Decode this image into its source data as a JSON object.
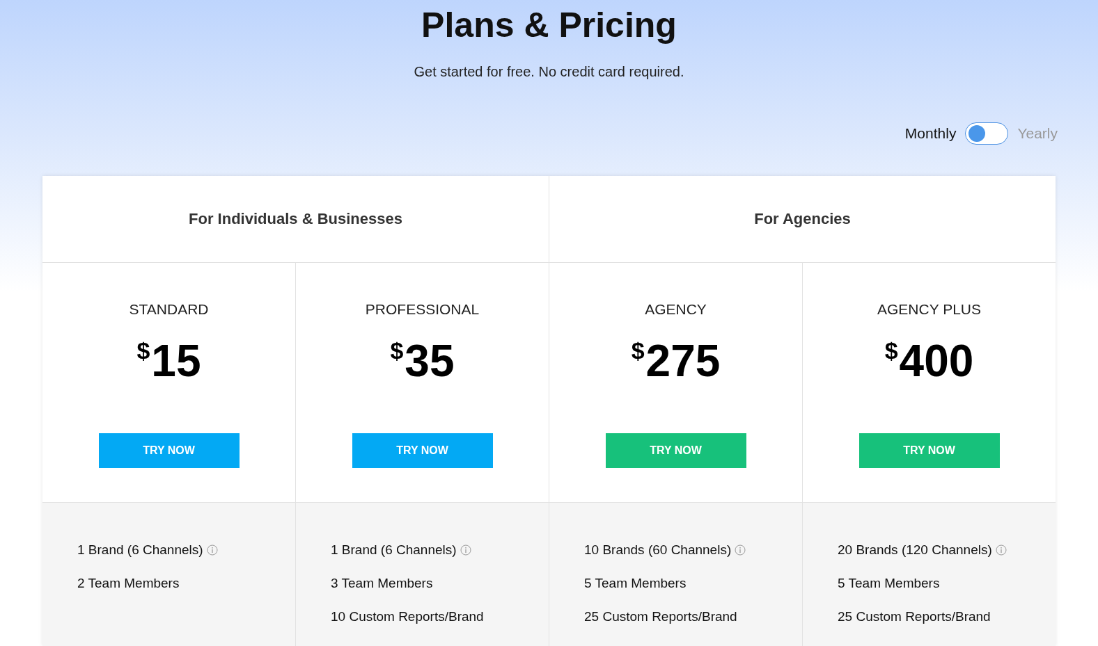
{
  "header": {
    "title": "Plans & Pricing",
    "subtitle": "Get started for free. No credit card required."
  },
  "billing": {
    "options": [
      {
        "label": "Monthly",
        "selected": true
      },
      {
        "label": "Yearly",
        "selected": false
      }
    ]
  },
  "groups": [
    {
      "title": "For Individuals & Businesses",
      "plans": [
        {
          "name": "STANDARD",
          "currency": "$",
          "amount": "15",
          "button": "TRY NOW",
          "color": "#03a9f4",
          "features": [
            {
              "text": "1 Brand (6 Channels)",
              "info": true
            },
            {
              "text": "2 Team Members",
              "info": false
            }
          ]
        },
        {
          "name": "PROFESSIONAL",
          "currency": "$",
          "amount": "35",
          "button": "TRY NOW",
          "color": "#03a9f4",
          "features": [
            {
              "text": "1 Brand (6 Channels)",
              "info": true
            },
            {
              "text": "3 Team Members",
              "info": false
            },
            {
              "text": "10 Custom Reports/Brand",
              "info": false
            }
          ]
        }
      ]
    },
    {
      "title": "For Agencies",
      "plans": [
        {
          "name": "AGENCY",
          "currency": "$",
          "amount": "275",
          "button": "TRY NOW",
          "color": "#17c17b",
          "features": [
            {
              "text": "10 Brands (60 Channels)",
              "info": true
            },
            {
              "text": "5 Team Members",
              "info": false
            },
            {
              "text": "25 Custom Reports/Brand",
              "info": false
            }
          ]
        },
        {
          "name": "AGENCY PLUS",
          "currency": "$",
          "amount": "400",
          "button": "TRY NOW",
          "color": "#17c17b",
          "features": [
            {
              "text": "20 Brands (120 Channels)",
              "info": true
            },
            {
              "text": "5 Team Members",
              "info": false
            },
            {
              "text": "25 Custom Reports/Brand",
              "info": false
            }
          ]
        }
      ]
    }
  ]
}
